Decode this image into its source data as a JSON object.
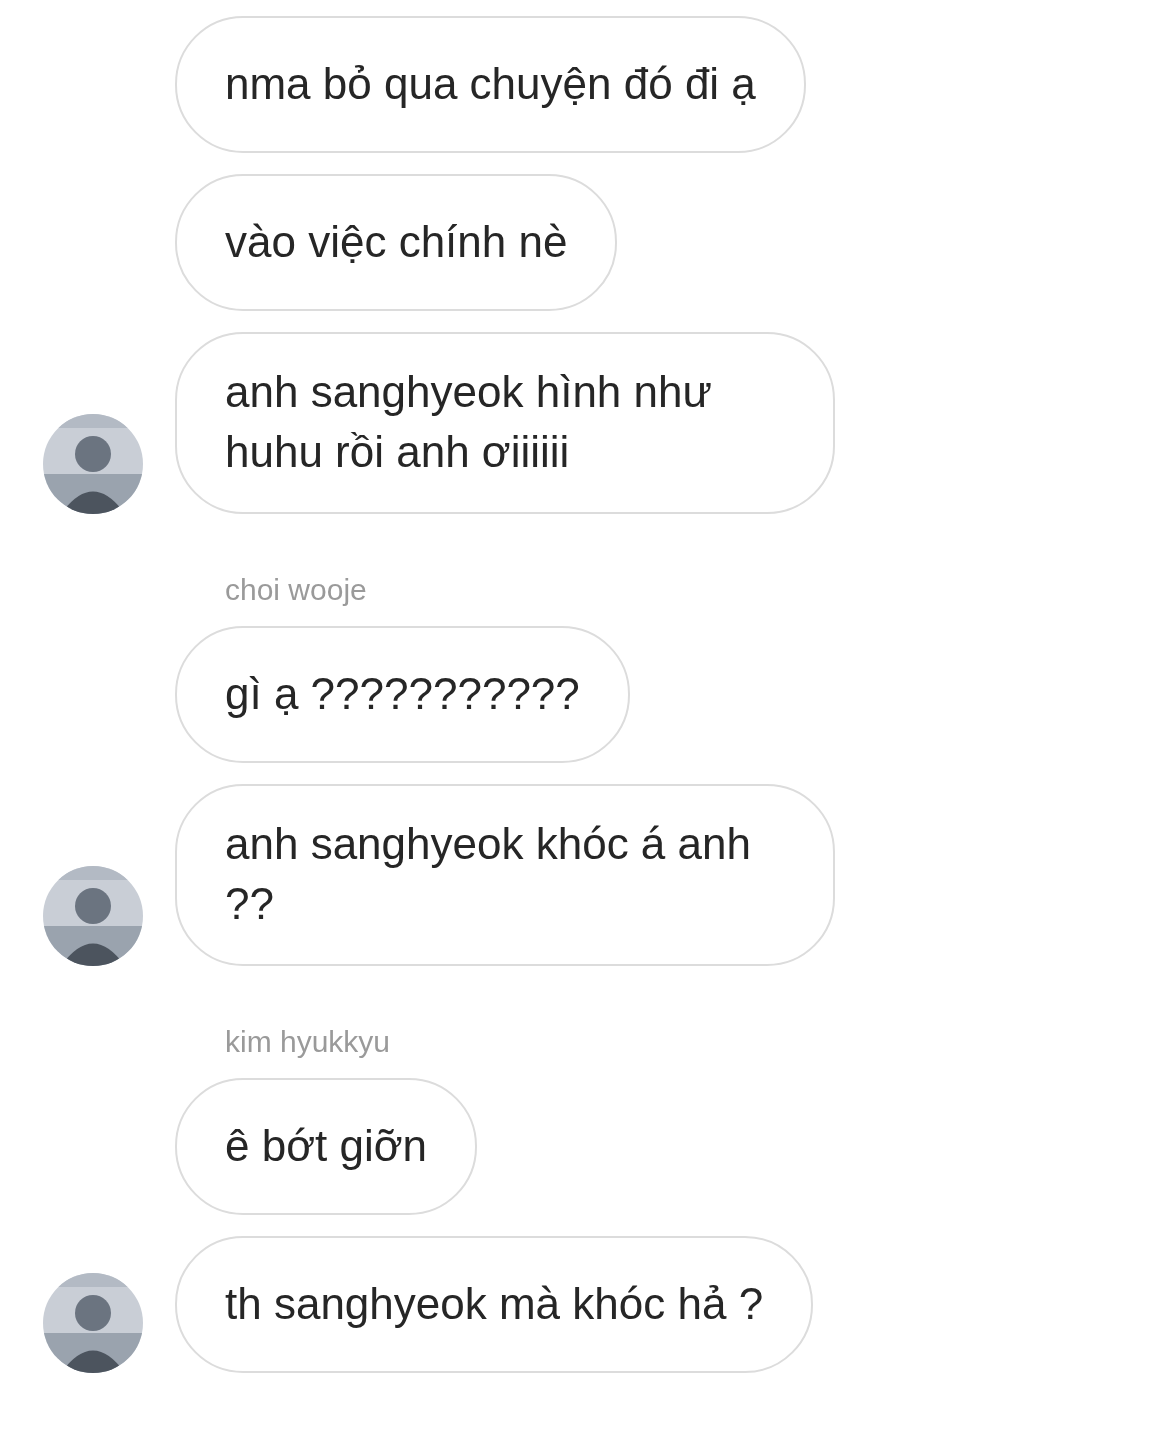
{
  "groups": [
    {
      "avatar": {
        "kind": "picture"
      },
      "messages": [
        {
          "text": "nma bỏ qua chuyện đó đi ạ"
        },
        {
          "text": "vào việc chính nè"
        },
        {
          "text": "anh sanghyeok hình như huhu rồi anh ơiiiiii"
        }
      ]
    },
    {
      "sender": "choi wooje",
      "avatar": {
        "kind": "picture"
      },
      "messages": [
        {
          "text": "gì ạ ???????????"
        },
        {
          "text": "anh sanghyeok khóc á anh ??"
        }
      ]
    },
    {
      "sender": "kim hyukkyu",
      "avatar": {
        "kind": "picture"
      },
      "messages": [
        {
          "text": "ê bớt giỡn"
        },
        {
          "text": "th sanghyeok mà khóc hả ?"
        }
      ]
    }
  ]
}
